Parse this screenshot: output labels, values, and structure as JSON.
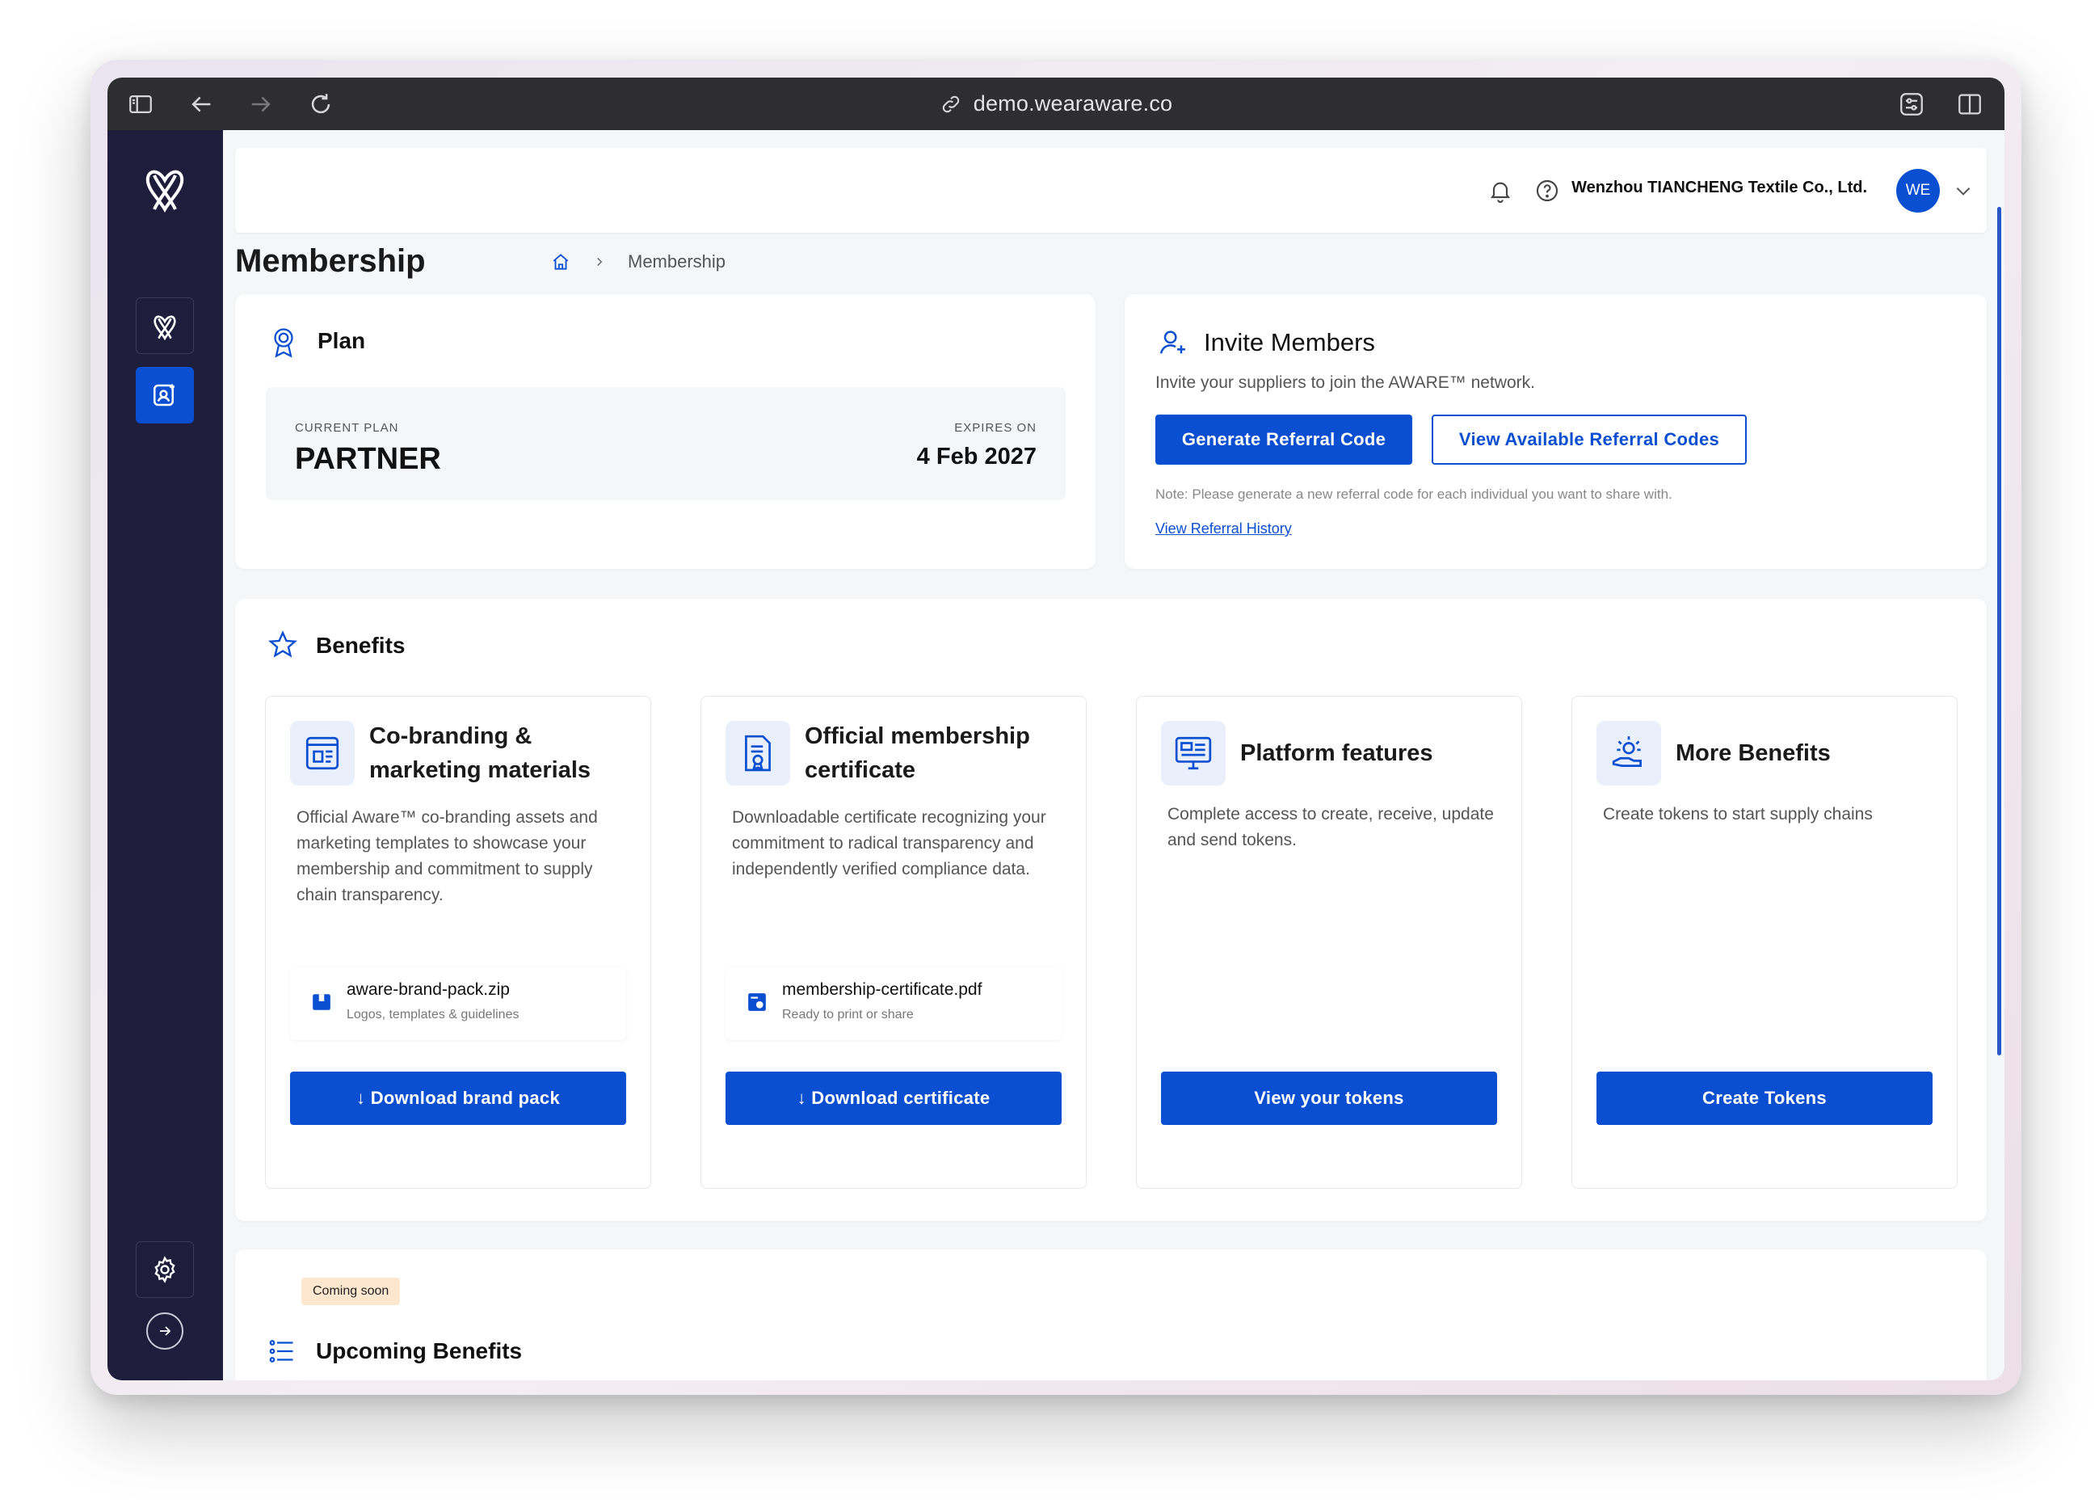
{
  "browser": {
    "url": "demo.wearaware.co"
  },
  "header": {
    "company": "Wenzhou TIANCHENG Textile Co., Ltd.",
    "avatar_initials": "WE"
  },
  "page": {
    "title": "Membership",
    "breadcrumb_current": "Membership"
  },
  "plan": {
    "title": "Plan",
    "current_plan_label": "CURRENT PLAN",
    "current_plan_value": "PARTNER",
    "expires_label": "EXPIRES ON",
    "expires_value": "4 Feb 2027"
  },
  "invite": {
    "title": "Invite Members",
    "description": "Invite your suppliers to join the AWARE™ network.",
    "generate_label": "Generate Referral Code",
    "view_codes_label": "View Available Referral Codes",
    "note": "Note: Please generate a new referral code for each individual you want to share with.",
    "history_link": "View Referral History"
  },
  "benefits": {
    "title": "Benefits",
    "items": [
      {
        "title": "Co-branding & marketing materials",
        "description": "Official Aware™ co-branding assets and marketing templates to showcase your membership and commitment to supply chain transparency.",
        "file_name": "aware-brand-pack.zip",
        "file_sub": "Logos, templates & guidelines",
        "button": "↓ Download brand pack"
      },
      {
        "title": "Official membership certificate",
        "description": "Downloadable certificate recognizing your commitment to radical transparency and independently verified compliance data.",
        "file_name": "membership-certificate.pdf",
        "file_sub": "Ready to print or share",
        "button": "↓ Download certificate"
      },
      {
        "title": "Platform features",
        "description": "Complete access to create, receive, update and send tokens.",
        "button": "View your tokens"
      },
      {
        "title": "More Benefits",
        "description": "Create tokens to start supply chains",
        "button": "Create Tokens"
      }
    ]
  },
  "upcoming": {
    "badge": "Coming soon",
    "title": "Upcoming Benefits"
  },
  "colors": {
    "primary": "#0a4fd1",
    "sidebar": "#1e1d3c",
    "chrome": "#2e2e30",
    "badge_bg": "#fde7cf"
  }
}
